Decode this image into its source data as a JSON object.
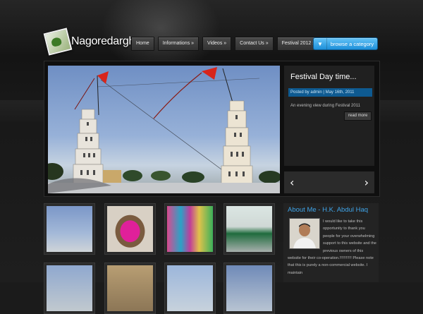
{
  "site": {
    "name": "Nagoredargha"
  },
  "nav": {
    "items": [
      {
        "label": "Home"
      },
      {
        "label": "Informations »"
      },
      {
        "label": "Videos »"
      },
      {
        "label": "Contact Us »"
      },
      {
        "label": "Festival 2012 »"
      }
    ]
  },
  "browse": {
    "label": "browse a category",
    "icon": "chevron-down-icon"
  },
  "slider": {
    "title": "Festival Day time...",
    "meta": "Posted by admin | May 16th, 2011",
    "description": "An evening view during Festival 2011",
    "read_more": "read more",
    "prev_icon": "‹",
    "next_icon": "›"
  },
  "about": {
    "title": "About Me - H.K. Abdul Haq",
    "text": "I would like to take this opportunity to thank you people for your overwhelming support to this website and the previous owners of this website for their co-operation.!!!!!!!!!!! Please note that this is purely a non-commercial website. I maintain"
  },
  "colors": {
    "accent": "#1d8fd9",
    "meta_bg": "#0e5a91",
    "about_title": "#3fa4e8"
  }
}
